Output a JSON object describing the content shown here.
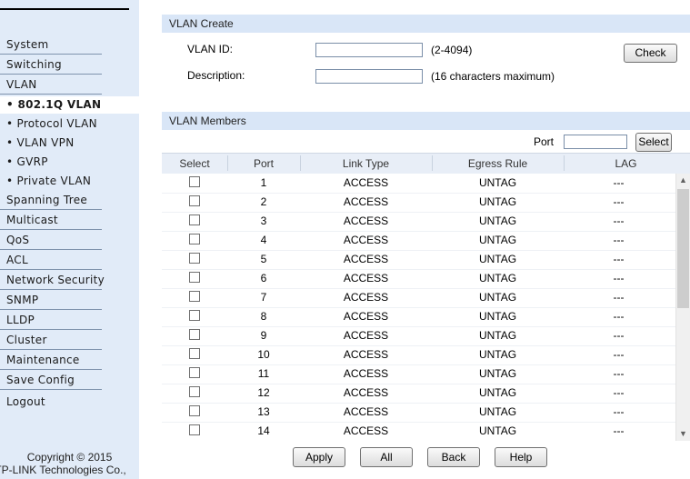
{
  "sidebar": {
    "items": [
      {
        "label": "System",
        "type": "main"
      },
      {
        "label": "Switching",
        "type": "main"
      },
      {
        "label": "VLAN",
        "type": "main"
      },
      {
        "label": "• 802.1Q VLAN",
        "type": "active"
      },
      {
        "label": "• Protocol VLAN",
        "type": "sub"
      },
      {
        "label": "• VLAN VPN",
        "type": "sub"
      },
      {
        "label": "• GVRP",
        "type": "sub"
      },
      {
        "label": "• Private VLAN",
        "type": "sub"
      },
      {
        "label": "Spanning Tree",
        "type": "main"
      },
      {
        "label": "Multicast",
        "type": "main"
      },
      {
        "label": "QoS",
        "type": "main"
      },
      {
        "label": "ACL",
        "type": "main"
      },
      {
        "label": "Network Security",
        "type": "main"
      },
      {
        "label": "SNMP",
        "type": "main"
      },
      {
        "label": "LLDP",
        "type": "main"
      },
      {
        "label": "Cluster",
        "type": "main"
      },
      {
        "label": "Maintenance",
        "type": "main"
      },
      {
        "label": "Save Config",
        "type": "main"
      }
    ],
    "logout": "Logout",
    "copyright_line1": "Copyright © 2015",
    "copyright_line2": "TP-LINK Technologies Co.,"
  },
  "vlan_create": {
    "title": "VLAN Create",
    "vlan_id_label": "VLAN ID:",
    "vlan_id_value": "",
    "vlan_id_hint": "(2-4094)",
    "description_label": "Description:",
    "description_value": "",
    "description_hint": "(16 characters maximum)",
    "check_button": "Check"
  },
  "vlan_members": {
    "title": "VLAN Members",
    "port_label": "Port",
    "port_value": "",
    "select_button": "Select",
    "columns": [
      "Select",
      "Port",
      "Link Type",
      "Egress Rule",
      "LAG"
    ],
    "rows": [
      {
        "port": "1",
        "link_type": "ACCESS",
        "egress": "UNTAG",
        "lag": "---"
      },
      {
        "port": "2",
        "link_type": "ACCESS",
        "egress": "UNTAG",
        "lag": "---"
      },
      {
        "port": "3",
        "link_type": "ACCESS",
        "egress": "UNTAG",
        "lag": "---"
      },
      {
        "port": "4",
        "link_type": "ACCESS",
        "egress": "UNTAG",
        "lag": "---"
      },
      {
        "port": "5",
        "link_type": "ACCESS",
        "egress": "UNTAG",
        "lag": "---"
      },
      {
        "port": "6",
        "link_type": "ACCESS",
        "egress": "UNTAG",
        "lag": "---"
      },
      {
        "port": "7",
        "link_type": "ACCESS",
        "egress": "UNTAG",
        "lag": "---"
      },
      {
        "port": "8",
        "link_type": "ACCESS",
        "egress": "UNTAG",
        "lag": "---"
      },
      {
        "port": "9",
        "link_type": "ACCESS",
        "egress": "UNTAG",
        "lag": "---"
      },
      {
        "port": "10",
        "link_type": "ACCESS",
        "egress": "UNTAG",
        "lag": "---"
      },
      {
        "port": "11",
        "link_type": "ACCESS",
        "egress": "UNTAG",
        "lag": "---"
      },
      {
        "port": "12",
        "link_type": "ACCESS",
        "egress": "UNTAG",
        "lag": "---"
      },
      {
        "port": "13",
        "link_type": "ACCESS",
        "egress": "UNTAG",
        "lag": "---"
      },
      {
        "port": "14",
        "link_type": "ACCESS",
        "egress": "UNTAG",
        "lag": "---"
      }
    ]
  },
  "footer_buttons": {
    "apply": "Apply",
    "all": "All",
    "back": "Back",
    "help": "Help"
  },
  "colors": {
    "sidebar_bg": "#e1ebf8",
    "panel_header_bg": "#d9e6f7"
  }
}
